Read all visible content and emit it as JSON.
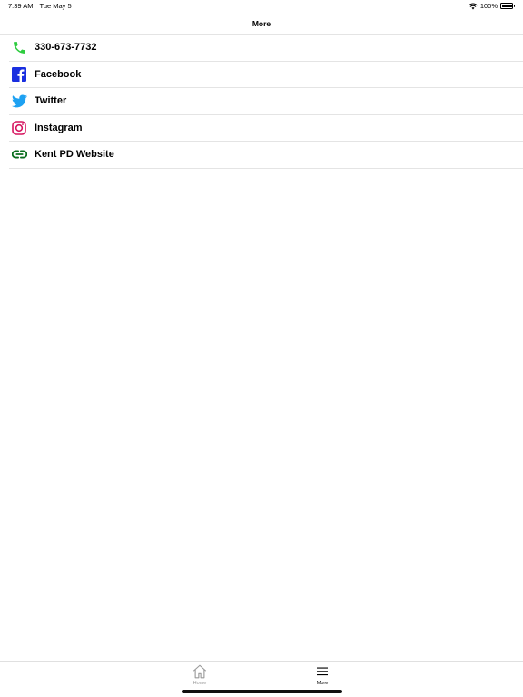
{
  "status_bar": {
    "time": "7:39 AM",
    "date": "Tue May 5",
    "battery": "100%",
    "battery_level": 1.0
  },
  "nav": {
    "title": "More"
  },
  "items": [
    {
      "label": "330-673-7732",
      "icon": "phone-icon",
      "color": "#2ecc40"
    },
    {
      "label": "Facebook",
      "icon": "facebook-icon",
      "color": "#1a2fe0"
    },
    {
      "label": "Twitter",
      "icon": "twitter-icon",
      "color": "#1da1f2"
    },
    {
      "label": "Instagram",
      "icon": "instagram-icon",
      "color": "#d6145f"
    },
    {
      "label": "Kent PD Website",
      "icon": "link-icon",
      "color": "#0a6e1e"
    }
  ],
  "tabs": [
    {
      "label": "Home",
      "icon": "house-icon",
      "active": false
    },
    {
      "label": "More",
      "icon": "hamburger-menu-icon",
      "active": true
    }
  ],
  "colors": {
    "inactive_tab": "#9a9a9a",
    "active_tab": "#000000",
    "separator": "#e4e4e4"
  }
}
